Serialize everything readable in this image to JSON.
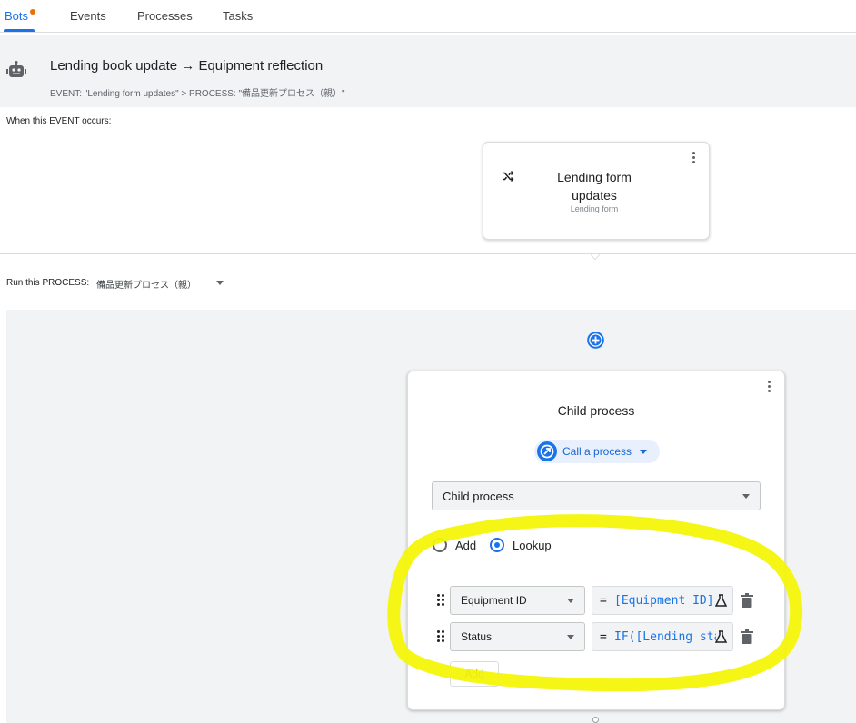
{
  "tabs": [
    {
      "label": "Bots",
      "active": true
    },
    {
      "label": "Events",
      "active": false
    },
    {
      "label": "Processes",
      "active": false
    },
    {
      "label": "Tasks",
      "active": false
    }
  ],
  "bot": {
    "title": "Lending book update → Equipment reflection",
    "subtitle": "EVENT: \"Lending form updates\" > PROCESS: \"備品更新プロセス（親）\""
  },
  "event_section": {
    "label": "When this EVENT occurs:",
    "card_title": "Lending form updates",
    "card_subtitle": "Lending form",
    "icon": "shuffle-icon"
  },
  "process_section": {
    "label": "Run this PROCESS:",
    "selected": "備品更新プロセス（親）"
  },
  "step": {
    "title": "Child process",
    "action_chip": "Call a process",
    "process_select": "Child process",
    "mode_options": [
      {
        "label": "Add",
        "checked": false
      },
      {
        "label": "Lookup",
        "checked": true
      }
    ],
    "rows": [
      {
        "column": "Equipment ID",
        "expression_prefix": "=",
        "expression": "[Equipment ID]"
      },
      {
        "column": "Status",
        "expression_prefix": "=",
        "expression": "IF([Lending status]"
      }
    ],
    "add_label": "Add"
  },
  "colors": {
    "accent": "#1a73e8",
    "tab_dot": "#e8710a",
    "highlight": "#f5f50a"
  }
}
